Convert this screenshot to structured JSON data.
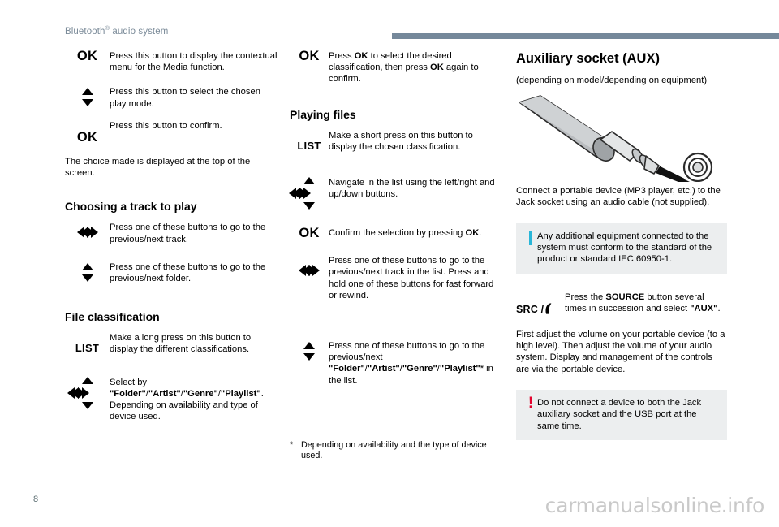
{
  "header": {
    "title_main": "Bluetooth",
    "title_sup": "®",
    "title_rest": " audio system",
    "rule_color": "#75889a",
    "title_color": "#7b8b99"
  },
  "column1": {
    "rows": [
      {
        "glyph": "OK",
        "glyph_type": "ok",
        "text": "Press this button to display the contextual menu for the Media function."
      },
      {
        "glyph": "up-down-arrows",
        "glyph_type": "updown",
        "text": "Press this button to select the chosen play mode."
      },
      {
        "glyph": "OK",
        "glyph_type": "ok",
        "text": "Press this button to confirm."
      }
    ],
    "paragraph": "The choice made is displayed at the top of the screen.",
    "heading_track": "Choosing a track to play",
    "track_rows": [
      {
        "glyph": "prev-next-arrows",
        "glyph_type": "prevnext",
        "text": "Press one of these buttons to go to the previous/next track."
      },
      {
        "glyph": "up-down-arrows",
        "glyph_type": "updown",
        "text": "Press one of these buttons to go to the previous/next folder."
      }
    ],
    "heading_classification": "File classification",
    "classification_rows": [
      {
        "glyph": "LIST",
        "glyph_type": "list",
        "text": "Make a long press on this button to display the different classifications."
      }
    ],
    "select_row": {
      "glyph": "dpad-arrows",
      "lead": "Select by ",
      "folder": "\"Folder\"",
      "sep1": "/",
      "artist": "\"Artist\"",
      "sep2": "/",
      "genre": "\"Genre\"",
      "sep3": "/",
      "playlist": "\"Playlist\"",
      "tail": ".",
      "line2": "Depending on availability and type of device used."
    }
  },
  "column2": {
    "ok_row": {
      "glyph": "OK",
      "part1": "Press ",
      "bold1": "OK",
      "part2": " to select the desired classification, then press ",
      "bold2": "OK",
      "part3": " again to confirm."
    },
    "heading_playing": "Playing files",
    "rows": [
      {
        "glyph": "LIST",
        "glyph_type": "list",
        "text": "Make a short press on this button to display the chosen classification."
      },
      {
        "glyph": "dpad-arrows",
        "glyph_type": "dpad",
        "text": "Navigate in the list using the left/right and up/down buttons."
      }
    ],
    "confirm_row": {
      "glyph": "OK",
      "part1": "Confirm the selection by pressing ",
      "bold1": "OK",
      "part2": "."
    },
    "prevnext_row": {
      "glyph": "prev-next-arrows",
      "text": "Press one of these buttons to go to the previous/next track in the list. Press and hold one of these buttons for fast forward or rewind."
    },
    "updown_row": {
      "glyph": "up-down-arrows",
      "lead": "Press one of these buttons to go to the previous/next ",
      "folder": "\"Folder\"",
      "sep1": "/",
      "artist": "\"Artist\"",
      "sep2": "/",
      "genre": "\"Genre\"",
      "sep3": "/",
      "playlist": "\"Playlist\"",
      "asterisk": "*",
      "tail": " in the list."
    },
    "footnote": {
      "marker": "*",
      "text": "Depending on availability and the type of device used."
    }
  },
  "column3": {
    "heading": "Auxiliary socket (AUX)",
    "subtitle": "(depending on model/depending on equipment)",
    "illustration_name": "jack-plug-and-socket-illustration",
    "paragraph1": "Connect a portable device (MP3 player, etc.) to the Jack socket using an audio cable (not supplied).",
    "info_box": {
      "icon": "info-bar-icon",
      "icon_color": "#29b6d8",
      "background": "#eceeef",
      "text": "Any additional equipment connected to the system must conform to the standard of the product or standard IEC 60950-1."
    },
    "src_row": {
      "glyph": "SRC /",
      "glyph_name": "src-phone-icon",
      "part1": "Press the ",
      "bold1": "SOURCE",
      "part2": " button several times in succession and select ",
      "bold2": "\"AUX\"",
      "part3": "."
    },
    "paragraph2": "First adjust the volume on your portable device (to a high level). Then adjust the volume of your audio system. Display and management of the controls are via the portable device.",
    "warning_box": {
      "icon": "exclamation-icon",
      "icon_color": "#e4032e",
      "background": "#eceeef",
      "text": "Do not connect a device to both the Jack auxiliary socket and the USB port at the same time."
    }
  },
  "footer": {
    "page_number": "8",
    "watermark": "carmanualsonline.info"
  }
}
